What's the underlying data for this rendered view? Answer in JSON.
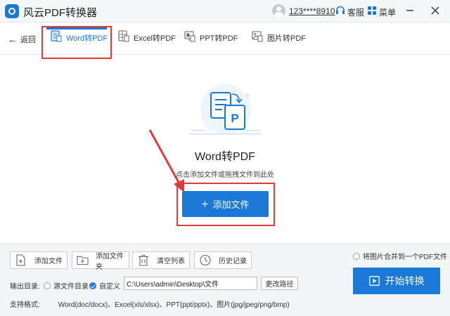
{
  "app": {
    "title": "风云PDF转换器"
  },
  "titlebar": {
    "user": "123****8910",
    "service": "客服",
    "menu": "菜单"
  },
  "nav": {
    "back": "返回",
    "tabs": [
      {
        "label": "Word转PDF",
        "active": true
      },
      {
        "label": "Excel转PDF",
        "active": false
      },
      {
        "label": "PPT转PDF",
        "active": false
      },
      {
        "label": "图片转PDF",
        "active": false
      }
    ]
  },
  "main": {
    "title": "Word转PDF",
    "hint": "点击添加文件或拖拽文件到此处",
    "add_button": "添加文件"
  },
  "toolbar": {
    "add_file": "添加文件",
    "add_folder": "添加文件夹",
    "clear_list": "清空列表",
    "history": "历史记录"
  },
  "merge_option": "将图片合并到一个PDF文件",
  "output": {
    "label": "输出目录:",
    "source_option": "源文件目录",
    "custom_option": "自定义",
    "path": "C:\\Users\\admin\\Desktop\\文件",
    "change_button": "更改路径"
  },
  "formats": {
    "label": "支持格式:",
    "value": "Word(doc/docx)、Excel(xls/xlsx)、PPT(ppt/pptx)、图片(jpg/jpeg/png/bmp)"
  },
  "start_button": "开始转换",
  "colors": {
    "accent": "#1b78d6",
    "highlight_annotation": "#e13a3a"
  }
}
